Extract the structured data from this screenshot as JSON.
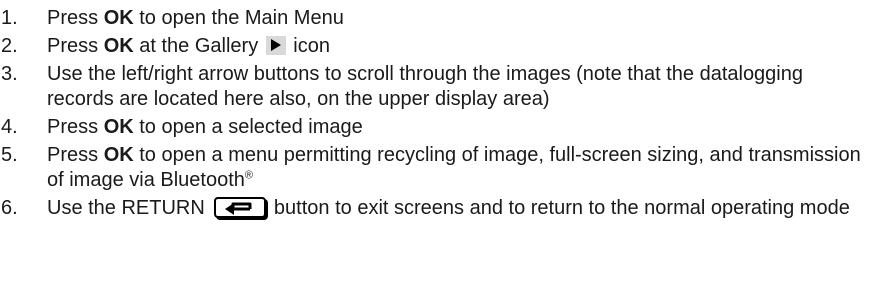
{
  "steps": [
    {
      "num": "1.",
      "pre": "Press ",
      "bold": "OK",
      "post": " to open the Main Menu"
    },
    {
      "num": "2.",
      "pre": "Press ",
      "bold": "OK",
      "mid": " at the Gallery ",
      "icon": "play-icon",
      "post": " icon"
    },
    {
      "num": "3.",
      "text": "Use the left/right arrow buttons to scroll through the images (note that the datalogging records are located here also, on the upper display area)"
    },
    {
      "num": "4.",
      "pre": "Press ",
      "bold": "OK",
      "post": " to open a selected image"
    },
    {
      "num": "5.",
      "pre": "Press ",
      "bold": "OK",
      "post": " to open a menu permitting recycling of image, full-screen sizing, and  transmission of image via Bluetooth",
      "sup": "®"
    },
    {
      "num": "6.",
      "pre": "Use the RETURN ",
      "icon": "return-arrow-icon",
      "post": " button to exit screens and to return to the normal operating mode"
    }
  ],
  "colors": {
    "text": "#1a1a1a",
    "icon_bg": "#d9d9d9"
  }
}
